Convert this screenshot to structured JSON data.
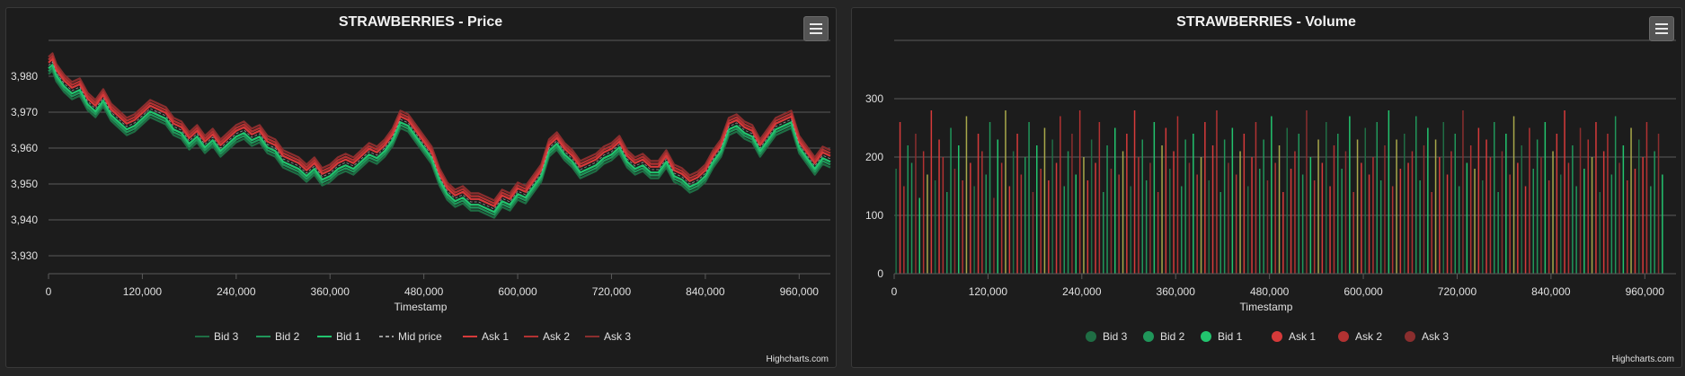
{
  "colors": {
    "background": "#1c1c1c",
    "grid": "#5a5a5a",
    "text": "#e0e0e0",
    "bid3": "#1f6d44",
    "bid2": "#20965a",
    "bid1": "#22c46e",
    "mid": "#9a9a9a",
    "ask1": "#d63a3a",
    "ask2": "#b23232",
    "ask3": "#8a2e2e"
  },
  "icons": {
    "menu": "hamburger-menu-icon"
  },
  "credits": "Highcharts.com",
  "chart_data": [
    {
      "type": "line",
      "title": "STRAWBERRIES - Price",
      "xlabel": "Timestamp",
      "ylabel": "",
      "xlim": [
        0,
        999900
      ],
      "ylim": [
        3925,
        3990
      ],
      "x_ticks": [
        "0",
        "120,000",
        "240,000",
        "360,000",
        "480,000",
        "600,000",
        "720,000",
        "840,000",
        "960,000"
      ],
      "y_ticks": [
        "3,930",
        "3,940",
        "3,950",
        "3,960",
        "3,970",
        "3,980"
      ],
      "grid": true,
      "legend_position": "bottom-center",
      "legend": [
        "Bid 3",
        "Bid 2",
        "Bid 1",
        "Mid price",
        "Ask 1",
        "Ask 2",
        "Ask 3"
      ],
      "x": [
        0,
        5000,
        10000,
        20000,
        30000,
        40000,
        50000,
        60000,
        70000,
        80000,
        90000,
        100000,
        110000,
        120000,
        130000,
        140000,
        150000,
        160000,
        170000,
        180000,
        190000,
        200000,
        210000,
        220000,
        230000,
        240000,
        250000,
        260000,
        270000,
        280000,
        290000,
        300000,
        310000,
        320000,
        330000,
        340000,
        350000,
        360000,
        370000,
        380000,
        390000,
        400000,
        410000,
        420000,
        430000,
        440000,
        450000,
        460000,
        470000,
        480000,
        490000,
        500000,
        510000,
        520000,
        530000,
        540000,
        550000,
        560000,
        570000,
        580000,
        590000,
        600000,
        610000,
        620000,
        630000,
        640000,
        650000,
        660000,
        670000,
        680000,
        690000,
        700000,
        710000,
        720000,
        730000,
        740000,
        750000,
        760000,
        770000,
        780000,
        790000,
        800000,
        810000,
        820000,
        830000,
        840000,
        850000,
        860000,
        870000,
        880000,
        890000,
        900000,
        910000,
        920000,
        930000,
        940000,
        950000,
        960000,
        970000,
        980000,
        990000,
        999900
      ],
      "series": [
        {
          "name": "Mid price",
          "values": [
            3983,
            3984,
            3981,
            3978,
            3976,
            3977,
            3973,
            3971,
            3974,
            3970,
            3968,
            3966,
            3967,
            3969,
            3971,
            3970,
            3969,
            3966,
            3965,
            3962,
            3964,
            3961,
            3963,
            3960,
            3962,
            3964,
            3965,
            3963,
            3964,
            3961,
            3960,
            3957,
            3956,
            3955,
            3953,
            3955,
            3952,
            3953,
            3955,
            3956,
            3955,
            3957,
            3959,
            3958,
            3960,
            3963,
            3968,
            3967,
            3964,
            3961,
            3958,
            3952,
            3948,
            3946,
            3947,
            3945,
            3945,
            3944,
            3943,
            3946,
            3945,
            3948,
            3947,
            3950,
            3953,
            3960,
            3962,
            3959,
            3957,
            3954,
            3955,
            3956,
            3958,
            3959,
            3961,
            3957,
            3955,
            3956,
            3954,
            3954,
            3957,
            3953,
            3952,
            3950,
            3951,
            3953,
            3957,
            3960,
            3966,
            3967,
            3965,
            3964,
            3960,
            3963,
            3966,
            3967,
            3968,
            3961,
            3958,
            3955,
            3958,
            3957
          ],
          "offsets": {
            "Bid 3": -2.4,
            "Bid 2": -1.6,
            "Bid 1": -0.8,
            "Ask 1": 0.8,
            "Ask 2": 1.6,
            "Ask 3": 2.4
          }
        }
      ]
    },
    {
      "type": "bar",
      "title": "STRAWBERRIES - Volume",
      "xlabel": "Timestamp",
      "ylabel": "",
      "xlim": [
        0,
        999900
      ],
      "ylim": [
        0,
        400
      ],
      "x_ticks": [
        "0",
        "120,000",
        "240,000",
        "360,000",
        "480,000",
        "600,000",
        "720,000",
        "840,000",
        "960,000"
      ],
      "y_ticks": [
        "0",
        "100",
        "200",
        "300"
      ],
      "grid": true,
      "legend_position": "bottom-center",
      "legend": [
        "Bid 3",
        "Bid 2",
        "Bid 1",
        "Ask 1",
        "Ask 2",
        "Ask 3"
      ],
      "bar_step": 5000,
      "series": [
        {
          "name": "Volume",
          "values": [
            180,
            260,
            150,
            220,
            190,
            240,
            130,
            210,
            170,
            280,
            160,
            230,
            200,
            140,
            250,
            180,
            220,
            160,
            270,
            190,
            150,
            240,
            210,
            170,
            260,
            130,
            230,
            190,
            280,
            150,
            210,
            240,
            170,
            200,
            260,
            140,
            220,
            180,
            250,
            160,
            230,
            190,
            270,
            150,
            210,
            240,
            170,
            280,
            200,
            160,
            230,
            190,
            260,
            140,
            220,
            180,
            250,
            170,
            210,
            240,
            150,
            280,
            200,
            230,
            160,
            190,
            260,
            140,
            220,
            250,
            180,
            210,
            270,
            150,
            230,
            190,
            240,
            170,
            200,
            260,
            160,
            220,
            280,
            140,
            230,
            190,
            250,
            170,
            210,
            240,
            150,
            200,
            260,
            180,
            230,
            160,
            270,
            190,
            220,
            140,
            250,
            180,
            210,
            240,
            170,
            280,
            200,
            160,
            230,
            190,
            260,
            150,
            220,
            240,
            180,
            210,
            270,
            140,
            230,
            190,
            250,
            170,
            200,
            260,
            160,
            220,
            280,
            150,
            230,
            180,
            240,
            190,
            210,
            270,
            160,
            220,
            250,
            140,
            230,
            200,
            260,
            170,
            210,
            240,
            150,
            280,
            190,
            220,
            180,
            250,
            160,
            230,
            200,
            260,
            140,
            210,
            240,
            170,
            270,
            190,
            220,
            150,
            250,
            180,
            230,
            200,
            260,
            160,
            210,
            240,
            170,
            280,
            190,
            220,
            150,
            250,
            180,
            230,
            200,
            260,
            140,
            210,
            240,
            170,
            270,
            190,
            220,
            160,
            250,
            180,
            230,
            200,
            260,
            150,
            210,
            240,
            170
          ]
        }
      ]
    }
  ]
}
